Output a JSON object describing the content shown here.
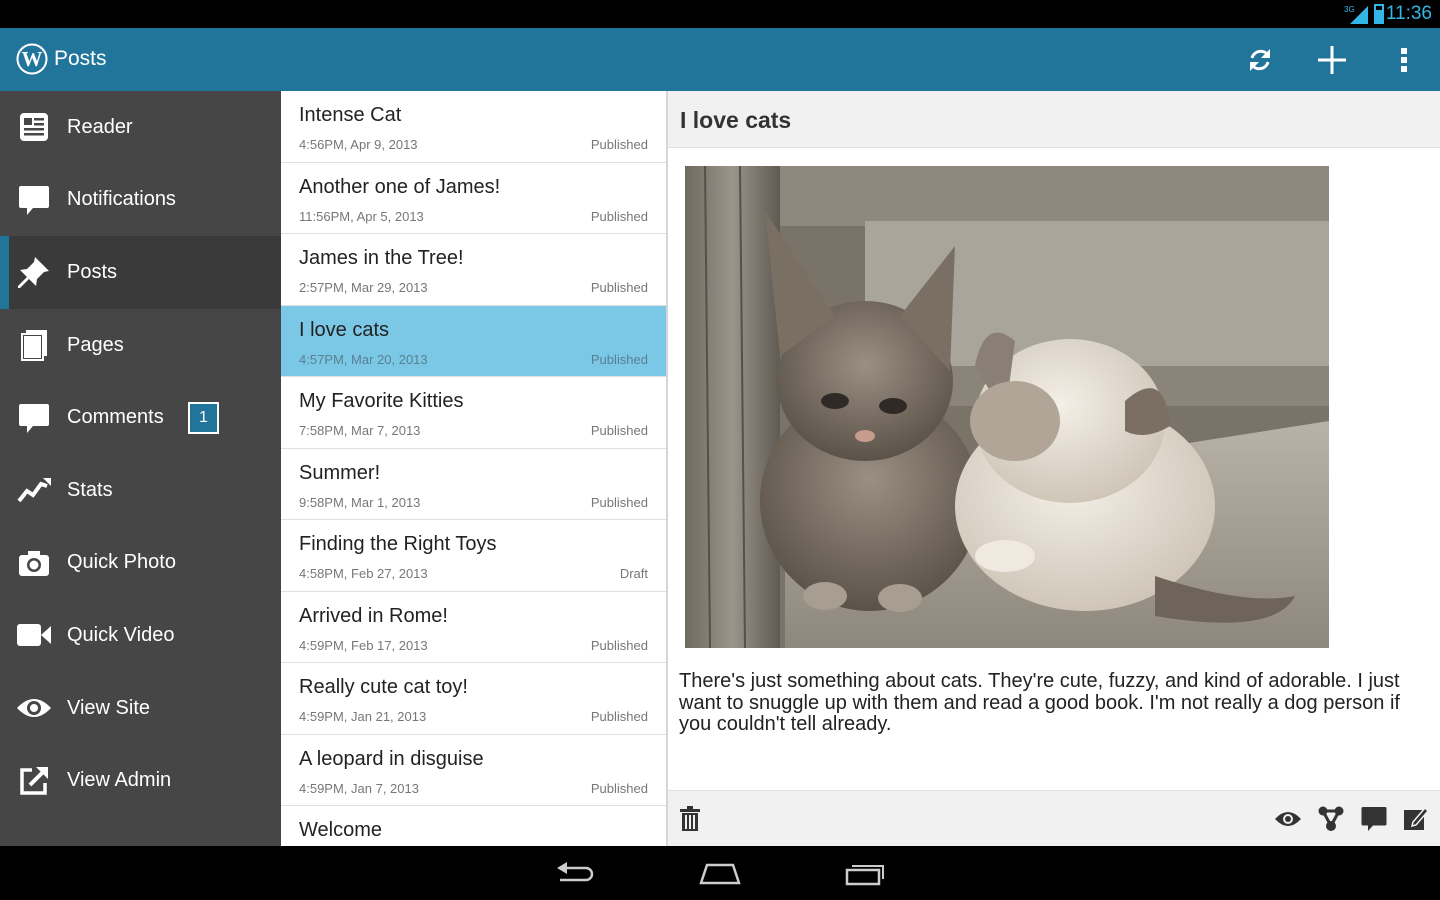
{
  "status_bar": {
    "network": "3G",
    "time": "11:36"
  },
  "action_bar": {
    "title": "Posts",
    "icons": [
      "wordpress-logo",
      "refresh-icon",
      "add-icon",
      "overflow-menu-icon"
    ]
  },
  "sidebar": {
    "items": [
      {
        "label": "Reader",
        "icon": "reader-icon"
      },
      {
        "label": "Notifications",
        "icon": "notifications-icon"
      },
      {
        "label": "Posts",
        "icon": "pin-icon",
        "active": true
      },
      {
        "label": "Pages",
        "icon": "pages-icon"
      },
      {
        "label": "Comments",
        "icon": "comments-icon",
        "badge": "1"
      },
      {
        "label": "Stats",
        "icon": "stats-icon"
      },
      {
        "label": "Quick Photo",
        "icon": "camera-icon"
      },
      {
        "label": "Quick Video",
        "icon": "video-icon"
      },
      {
        "label": "View Site",
        "icon": "eye-icon"
      },
      {
        "label": "View Admin",
        "icon": "external-link-icon"
      }
    ]
  },
  "posts": [
    {
      "title": "Intense Cat",
      "date": "4:56PM, Apr 9, 2013",
      "status": "Published"
    },
    {
      "title": "Another one of James!",
      "date": "11:56PM, Apr 5, 2013",
      "status": "Published"
    },
    {
      "title": "James in the Tree!",
      "date": "2:57PM, Mar 29, 2013",
      "status": "Published"
    },
    {
      "title": "I love cats",
      "date": "4:57PM, Mar 20, 2013",
      "status": "Published",
      "selected": true
    },
    {
      "title": "My Favorite Kitties",
      "date": "7:58PM, Mar 7, 2013",
      "status": "Published"
    },
    {
      "title": "Summer!",
      "date": "9:58PM, Mar 1, 2013",
      "status": "Published"
    },
    {
      "title": "Finding the Right Toys",
      "date": "4:58PM, Feb 27, 2013",
      "status": "Draft"
    },
    {
      "title": "Arrived in Rome!",
      "date": "4:59PM, Feb 17, 2013",
      "status": "Published"
    },
    {
      "title": "Really cute cat toy!",
      "date": "4:59PM, Jan 21, 2013",
      "status": "Published"
    },
    {
      "title": "A leopard in disguise",
      "date": "4:59PM, Jan 7, 2013",
      "status": "Published"
    },
    {
      "title": "Welcome",
      "date": "",
      "status": ""
    }
  ],
  "detail": {
    "title": "I love cats",
    "body": "There's just something about cats. They're cute, fuzzy, and kind of adorable. I just want to snuggle up with them and read a good book. I'm not really a dog person if you couldn't tell already.",
    "footer_icons": [
      "trash-icon",
      "preview-icon",
      "share-icon",
      "comment-icon",
      "edit-icon"
    ]
  },
  "colors": {
    "accent": "#21759b",
    "selected_row": "#7ac8e6",
    "sidebar_bg": "#464646",
    "holo_blue": "#33b5e5"
  }
}
